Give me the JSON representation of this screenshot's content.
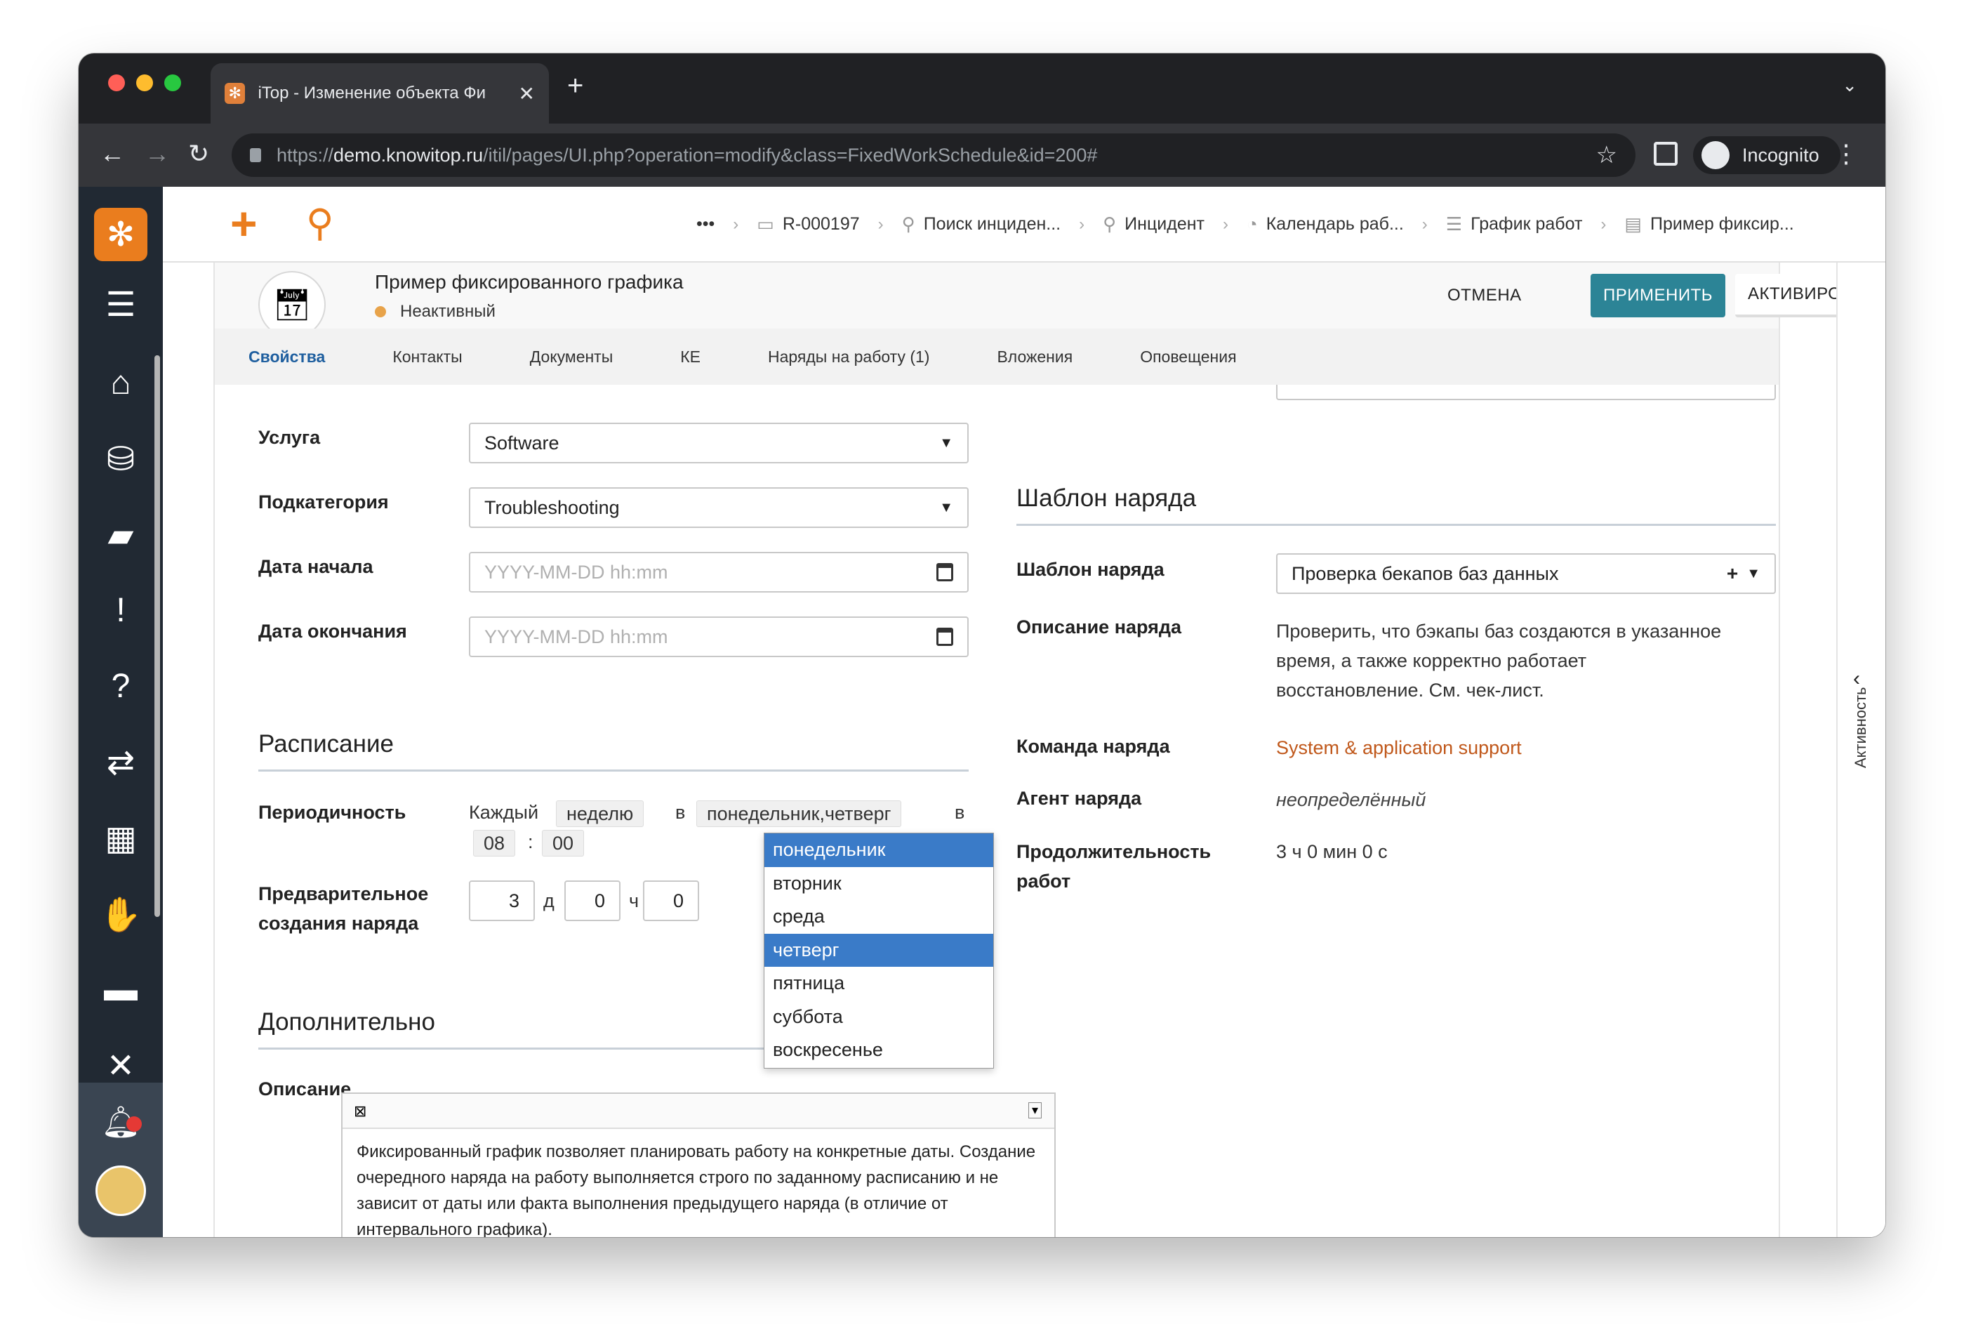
{
  "browser": {
    "tab_title": "iTop - Изменение объекта Фи",
    "url_scheme": "https://",
    "url_host": "demo.knowitop.ru",
    "url_path": "/itil/pages/UI.php?operation=modify&class=FixedWorkSchedule&id=200#",
    "incognito_label": "Incognito"
  },
  "breadcrumb": {
    "ellipsis": "•••",
    "items": [
      "R-000197",
      "Поиск инциден...",
      "Инцидент",
      "Календарь раб...",
      "График работ",
      "Пример фиксир..."
    ]
  },
  "object": {
    "title": "Пример фиксированного графика",
    "status": "Неактивный",
    "buttons": {
      "cancel": "ОТМЕНА",
      "apply": "ПРИМЕНИТЬ",
      "activate": "АКТИВИРОВАТЬ"
    },
    "tabs": [
      "Свойства",
      "Контакты",
      "Документы",
      "КЕ",
      "Наряды на работу (1)",
      "Вложения",
      "Оповещения"
    ]
  },
  "form_left": {
    "service_label": "Услуга",
    "service_value": "Software",
    "subcategory_label": "Подкатегория",
    "subcategory_value": "Troubleshooting",
    "start_date_label": "Дата начала",
    "start_date_placeholder": "YYYY-MM-DD hh:mm",
    "end_date_label": "Дата окончания",
    "end_date_placeholder": "YYYY-MM-DD hh:mm",
    "schedule_section": "Расписание",
    "periodicity_label": "Периодичность",
    "periodicity_every": "Каждый",
    "periodicity_unit": "неделю",
    "periodicity_in": "в",
    "periodicity_days": "понедельник,четверг",
    "periodicity_at": "в",
    "time_hours": "08",
    "time_colon": ":",
    "time_minutes": "00",
    "advance_label_1": "Предварительное",
    "advance_label_2": "создания наряда",
    "advance_days": "3",
    "advance_days_unit": "д",
    "advance_hours": "0",
    "advance_hours_unit": "ч",
    "advance_minutes": "0",
    "additional_section": "Дополнительно",
    "description_label": "Описание",
    "description_text": "Фиксированный график позволяет планировать работу на конкретные даты. Создание очередного наряда на работу выполняется строго по заданному расписанию и не зависит от даты или факта выполнения предыдущего наряда (в отличие от интервального графика)."
  },
  "day_dropdown": {
    "options": [
      {
        "label": "понедельник",
        "selected": true
      },
      {
        "label": "вторник",
        "selected": false
      },
      {
        "label": "среда",
        "selected": false
      },
      {
        "label": "четверг",
        "selected": true
      },
      {
        "label": "пятница",
        "selected": false
      },
      {
        "label": "суббота",
        "selected": false
      },
      {
        "label": "воскресенье",
        "selected": false
      }
    ]
  },
  "form_right": {
    "template_section": "Шаблон наряда",
    "template_label": "Шаблон наряда",
    "template_value": "Проверка бекапов баз данных",
    "template_desc_label": "Описание наряда",
    "template_desc_lines": [
      "Проверить, что бэкапы баз создаются в указанное",
      "время, а также корректно работает",
      "восстановление. См. чек-лист."
    ],
    "team_label": "Команда наряда",
    "team_value": "System & application support",
    "agent_label": "Агент наряда",
    "agent_value": "неопределённый",
    "duration_label_1": "Продолжительность",
    "duration_label_2": "работ",
    "duration_value": "3 ч 0 мин 0 с"
  },
  "activity_panel": {
    "label": "Активность"
  },
  "colors": {
    "accent": "#ea7d1e",
    "apply_button": "#2c8496",
    "nav_bg": "#212933",
    "link": "#c0581b",
    "dropdown_selected": "#3a7bc8"
  }
}
